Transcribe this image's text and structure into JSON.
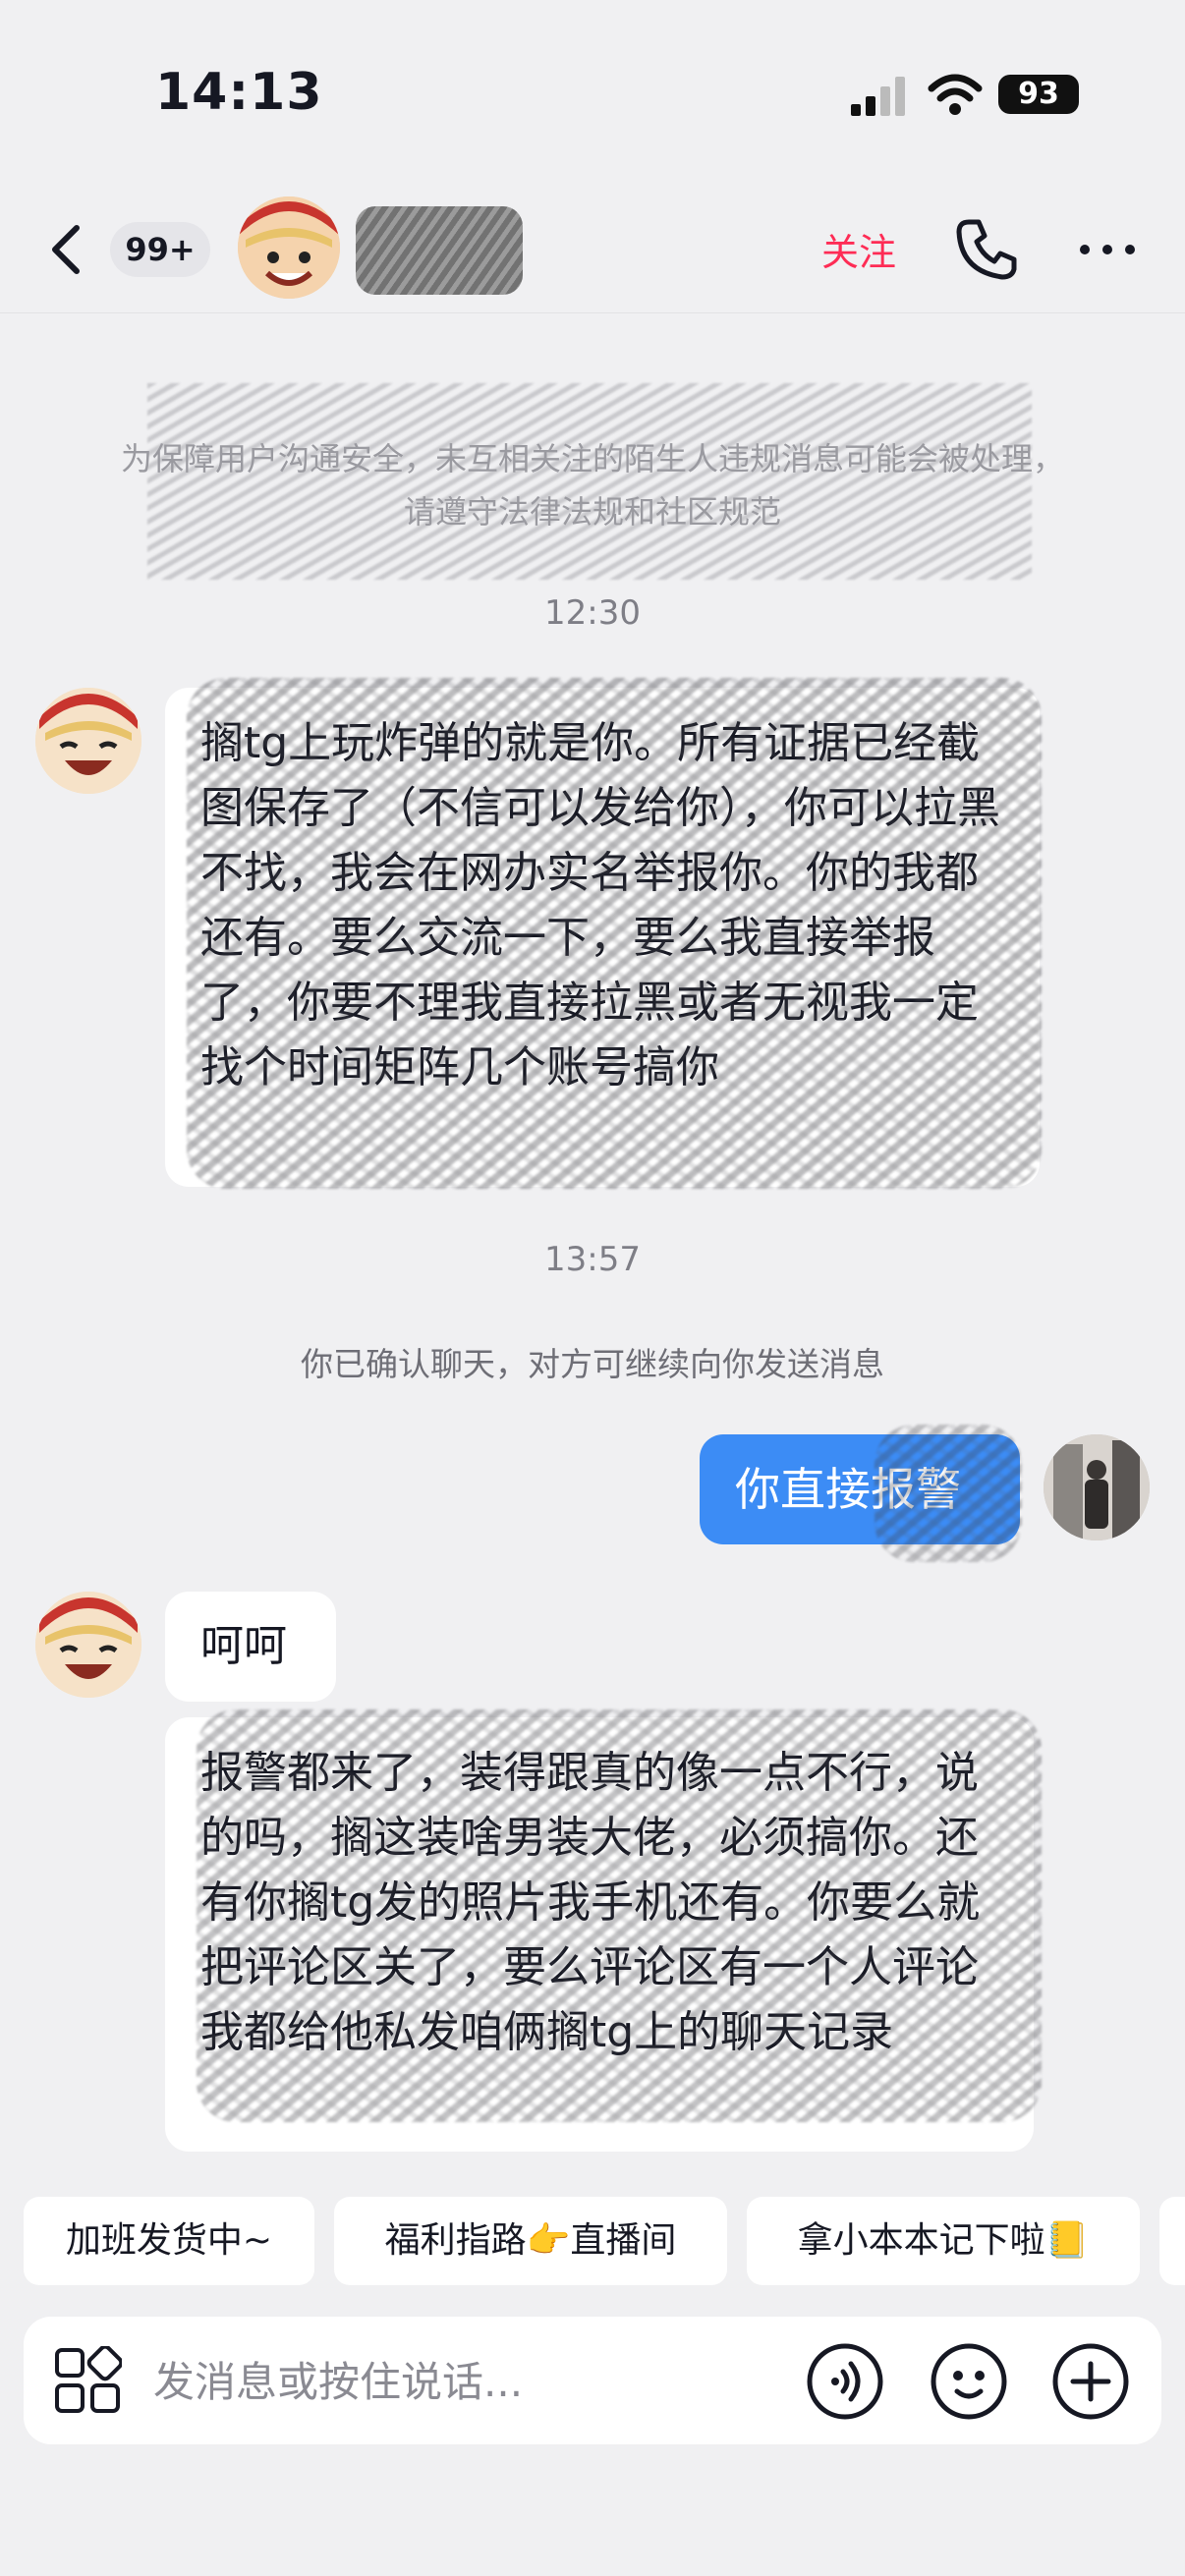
{
  "status_bar": {
    "time": "14:13",
    "battery": "93"
  },
  "header": {
    "unread_badge": "99+",
    "follow_label": "关注"
  },
  "chat": {
    "safety_notice": "为保障用户沟通安全，未互相关注的陌生人违规消息可能会被处理，请遵守法律法规和社区规范",
    "timestamp_1": "12:30",
    "message_1": "搁tg上玩炸弹的就是你。所有证据已经截图保存了（不信可以发给你），你可以拉黑不找，我会在网办实名举报你。你的我都还有。要么交流一下，要么我直接举报了，你要不理我直接拉黑或者无视我一定找个时间矩阵几个账号搞你",
    "timestamp_2": "13:57",
    "system_message": "你已确认聊天，对方可继续向你发送消息",
    "my_message": "你直接报警",
    "message_2": "呵呵",
    "message_3": "报警都来了，装得跟真的像一点不行，说的吗，搁这装啥男装大佬，必须搞你。还有你搁tg发的照片我手机还有。你要么就把评论区关了，要么评论区有一个人评论我都给他私发咱俩搁tg上的聊天记录"
  },
  "quick_replies": [
    "加班发货中~",
    "福利指路👉直播间",
    "拿小本本记下啦📒"
  ],
  "input_bar": {
    "placeholder": "发消息或按住说话..."
  },
  "colors": {
    "accent": "#fe2c55",
    "my_bubble": "#3c8cf5",
    "background": "#f0f0f2"
  }
}
